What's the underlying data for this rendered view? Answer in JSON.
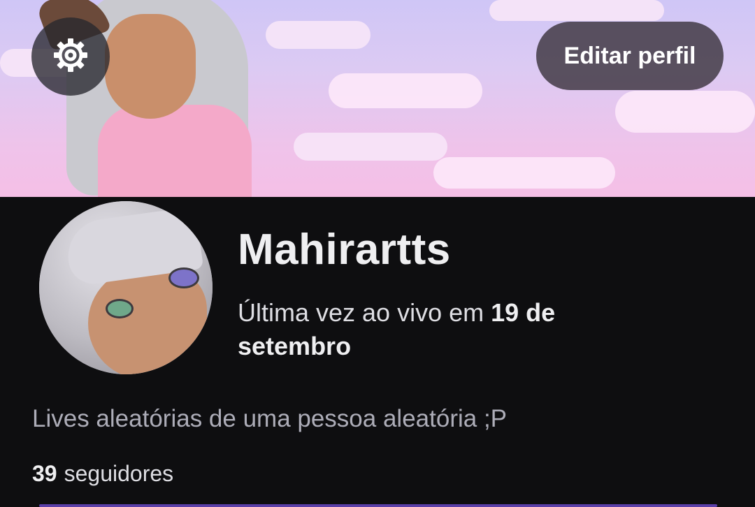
{
  "header": {
    "edit_profile_label": "Editar perfil",
    "settings_icon": "gear-icon"
  },
  "profile": {
    "username": "Mahirartts",
    "last_live_prefix": "Última vez ao vivo em ",
    "last_live_date": "19 de setembro",
    "bio": "Lives aleatórias de uma pessoa aleatória ;P",
    "followers_count": "39",
    "followers_label": "seguidores"
  },
  "colors": {
    "background": "#0e0e10",
    "accent": "#5b3fa8"
  }
}
